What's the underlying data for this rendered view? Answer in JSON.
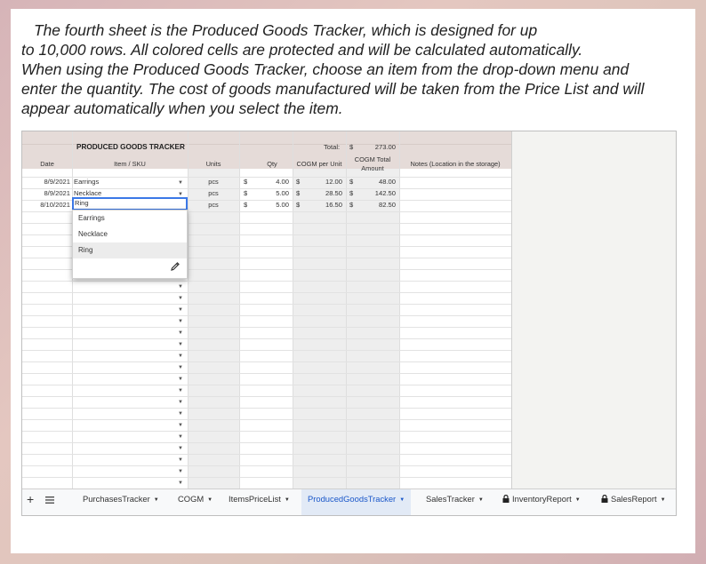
{
  "intro": {
    "line1": "The fourth sheet is the Produced Goods Tracker, which is designed for up",
    "line2": "to 10,000 rows. All colored cells are protected and will be calculated automatically.",
    "line3": "When using the Produced Goods Tracker, choose an item from the drop-down menu and",
    "line4": "enter the quantity. The cost of goods manufactured will be taken from the Price List and will",
    "line5": "appear automatically when you select the item."
  },
  "sheet": {
    "title": "PRODUCED GOODS TRACKER",
    "total_label": "Total:",
    "total_currency": "$",
    "total_value": "273.00",
    "headers": {
      "date": "Date",
      "item": "Item / SKU",
      "units": "Units",
      "qty": "Qty",
      "cogm_unit": "COGM per Unit",
      "cogm_total_1": "COGM Total",
      "cogm_total_2": "Amount",
      "notes": "Notes (Location in the storage)"
    },
    "currency": "$",
    "rows": [
      {
        "date": "8/9/2021",
        "item": "Earrings",
        "units": "pcs",
        "qty": "4.00",
        "cogm_unit": "12.00",
        "cogm_total": "48.00"
      },
      {
        "date": "8/9/2021",
        "item": "Necklace",
        "units": "pcs",
        "qty": "5.00",
        "cogm_unit": "28.50",
        "cogm_total": "142.50"
      },
      {
        "date": "8/10/2021",
        "item": "Ring",
        "units": "pcs",
        "qty": "5.00",
        "cogm_unit": "16.50",
        "cogm_total": "82.50"
      }
    ],
    "dropdown_options": [
      "Earrings",
      "Necklace",
      "Ring"
    ],
    "dropdown_selected": "Ring"
  },
  "tabs": [
    {
      "label": "PurchasesTracker",
      "locked": false,
      "active": false
    },
    {
      "label": "COGM",
      "locked": false,
      "active": false
    },
    {
      "label": "ItemsPriceList",
      "locked": false,
      "active": false
    },
    {
      "label": "ProducedGoodsTracker",
      "locked": false,
      "active": true
    },
    {
      "label": "SalesTracker",
      "locked": false,
      "active": false
    },
    {
      "label": "InventoryReport",
      "locked": true,
      "active": false
    },
    {
      "label": "SalesReport",
      "locked": true,
      "active": false
    }
  ],
  "icons": {
    "add_sheet": "plus-icon",
    "all_sheets": "menu-icon",
    "tab_arrow": "caret-down-icon",
    "lock": "lock-icon",
    "edit": "pencil-icon"
  },
  "colors": {
    "header": "#e5dbd8",
    "calculated": "#eeeeee",
    "active_tab": "#e2eaf6",
    "accent": "#1a57c9",
    "selection": "#3b78e7"
  }
}
